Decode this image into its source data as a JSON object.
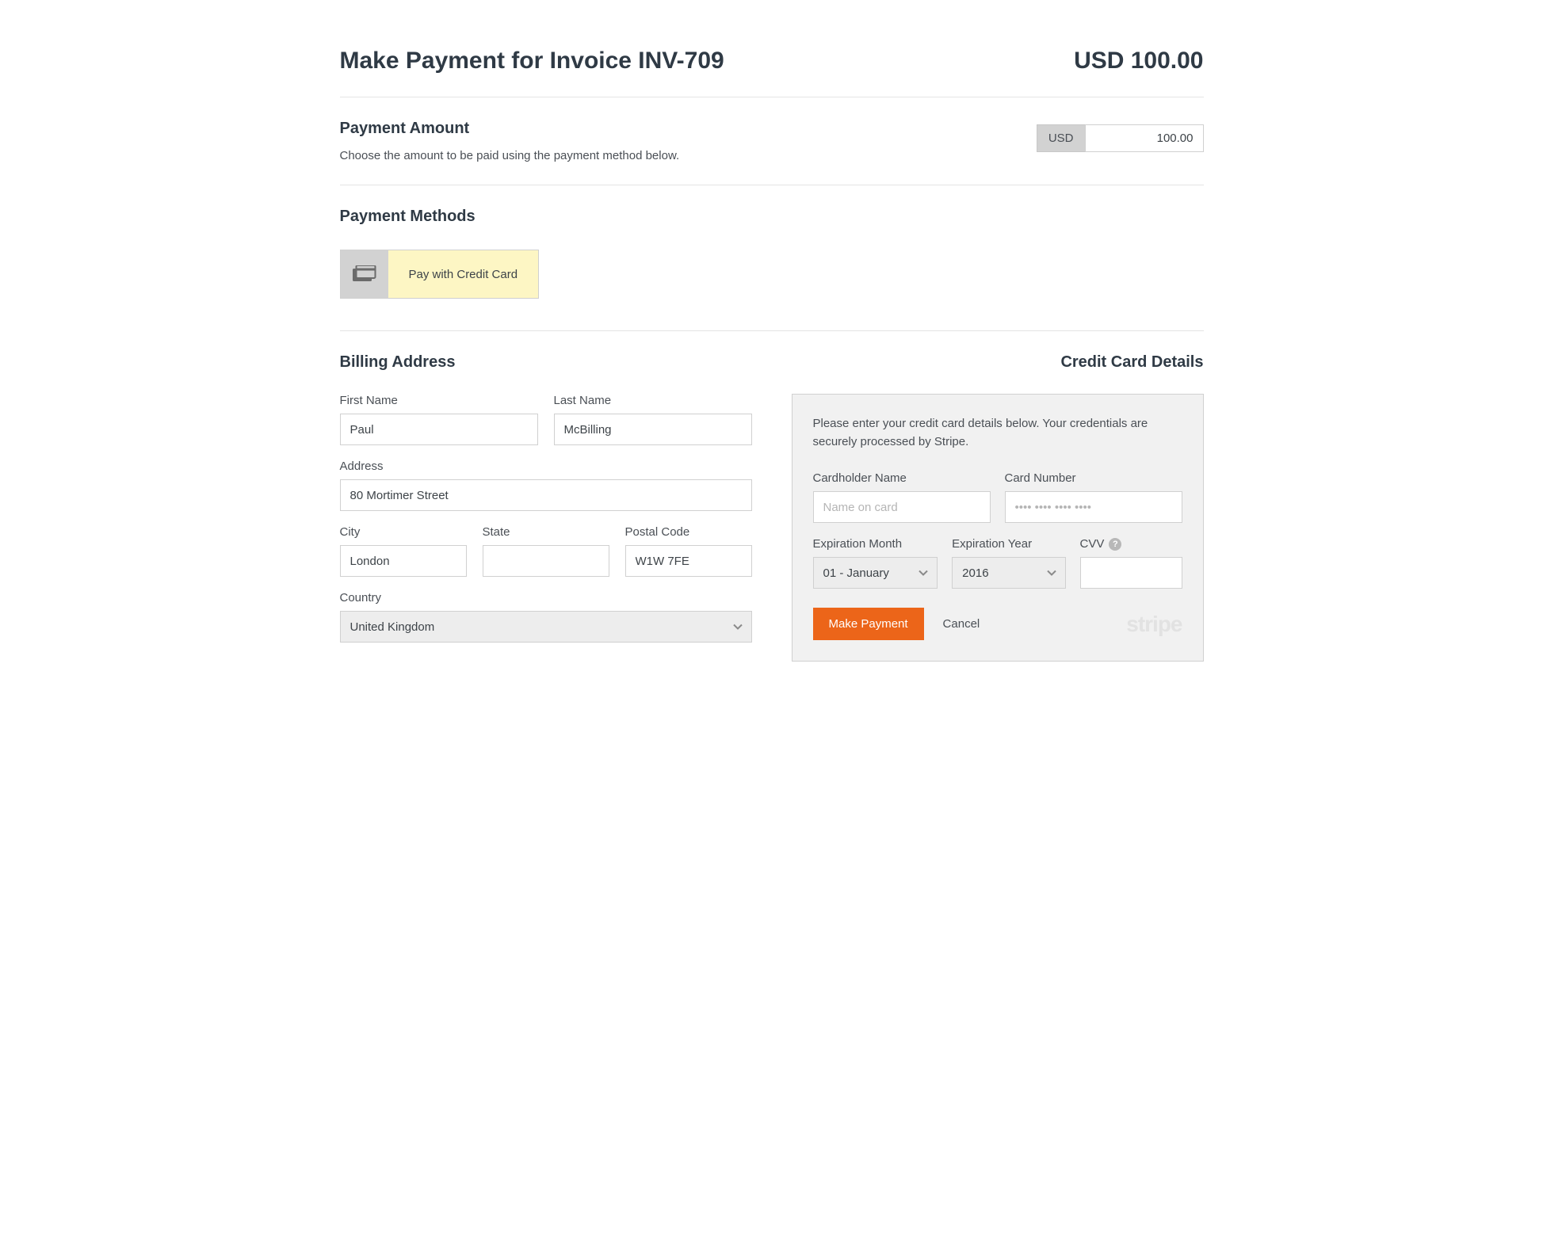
{
  "header": {
    "title": "Make Payment for Invoice INV-709",
    "amount": "USD 100.00"
  },
  "payment_amount": {
    "title": "Payment Amount",
    "subtitle": "Choose the amount to be paid using the payment method below.",
    "currency_prefix": "USD",
    "value": "100.00"
  },
  "payment_methods": {
    "title": "Payment Methods",
    "credit_card_label": "Pay with Credit Card"
  },
  "billing": {
    "title": "Billing Address",
    "first_name_label": "First Name",
    "first_name": "Paul",
    "last_name_label": "Last Name",
    "last_name": "McBilling",
    "address_label": "Address",
    "address": "80 Mortimer Street",
    "city_label": "City",
    "city": "London",
    "state_label": "State",
    "state": "",
    "postal_label": "Postal Code",
    "postal": "W1W 7FE",
    "country_label": "Country",
    "country": "United Kingdom"
  },
  "card": {
    "title": "Credit Card Details",
    "intro": "Please enter your credit card details below. Your credentials are securely processed by Stripe.",
    "holder_label": "Cardholder Name",
    "holder_placeholder": "Name on card",
    "number_label": "Card Number",
    "number_placeholder": "•••• •••• •••• ••••",
    "exp_month_label": "Expiration Month",
    "exp_month_value": "01 - January",
    "exp_year_label": "Expiration Year",
    "exp_year_value": "2016",
    "cvv_label": "CVV",
    "make_payment": "Make Payment",
    "cancel": "Cancel",
    "processor": "stripe"
  }
}
